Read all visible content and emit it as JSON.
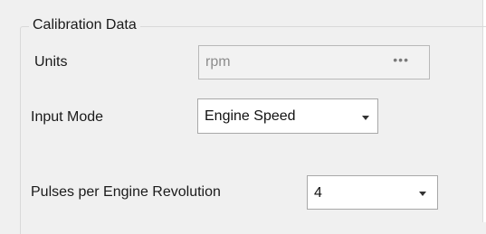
{
  "group": {
    "title": "Calibration Data"
  },
  "units": {
    "label": "Units",
    "value": "rpm",
    "browse_label": "•••"
  },
  "input_mode": {
    "label": "Input Mode",
    "value": "Engine Speed"
  },
  "pulses": {
    "label": "Pulses per Engine Revolution",
    "value": "4"
  }
}
